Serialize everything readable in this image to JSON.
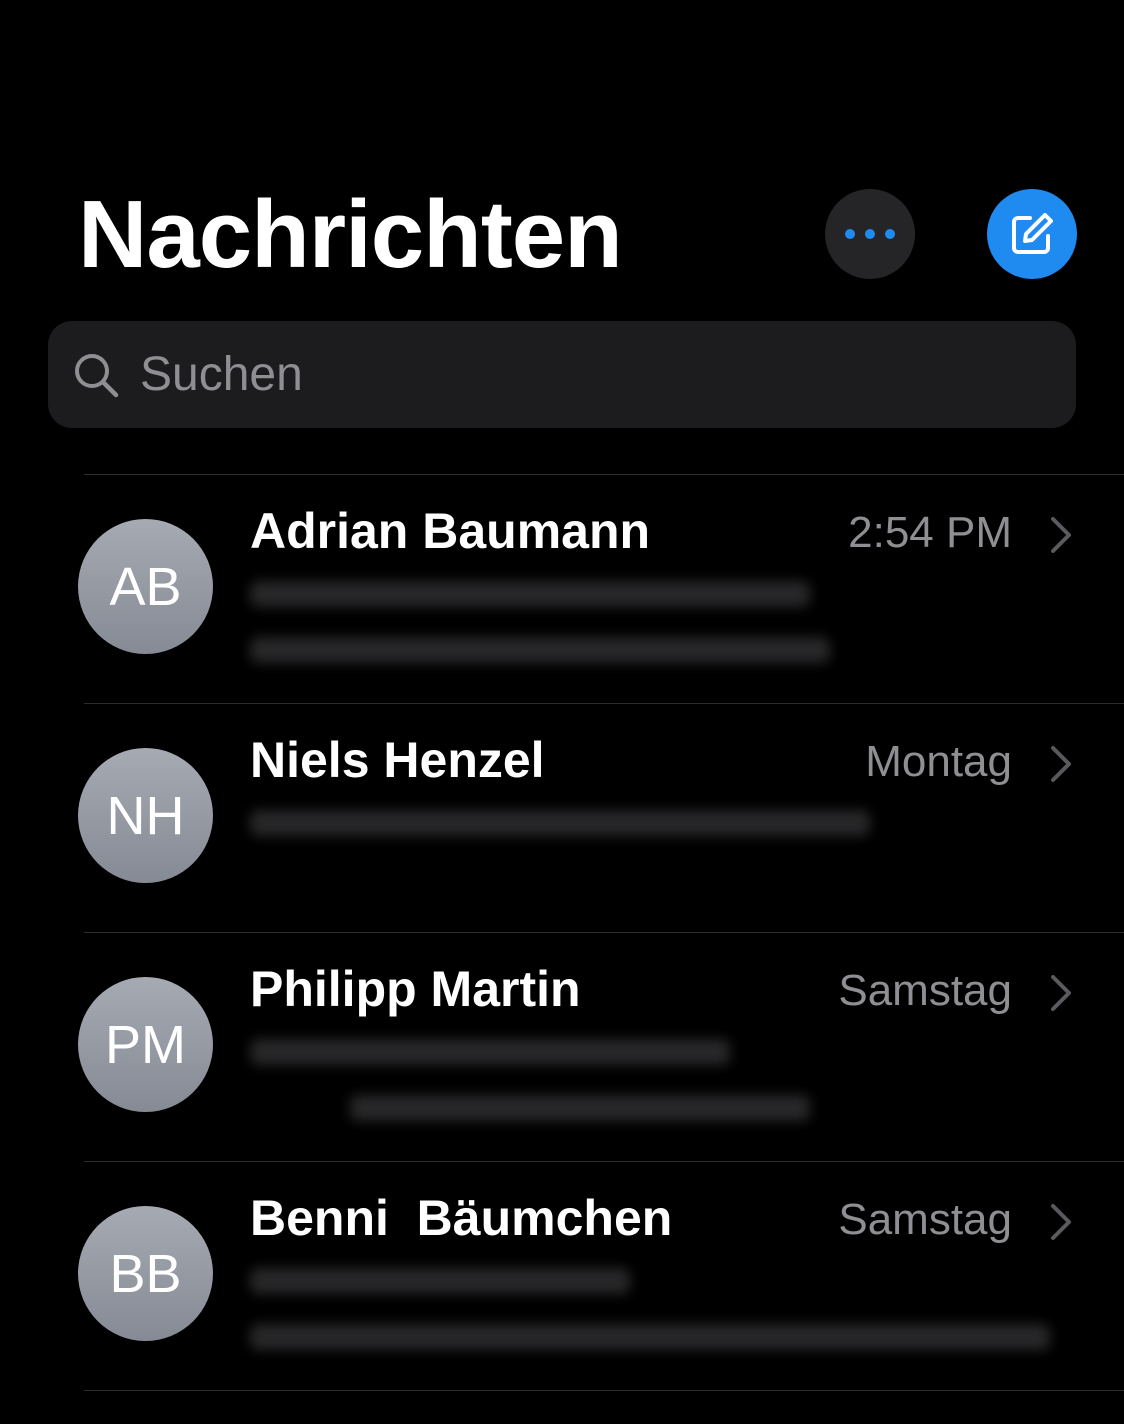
{
  "header": {
    "title": "Nachrichten",
    "more_icon": "ellipsis-icon",
    "compose_icon": "compose-icon",
    "accent_color": "#1f8bf0"
  },
  "search": {
    "placeholder": "Suchen",
    "icon": "search-icon"
  },
  "conversations": [
    {
      "initials": "AB",
      "name": "Adrian Baumann",
      "time": "2:54 PM"
    },
    {
      "initials": "NH",
      "name": "Niels Henzel",
      "time": "Montag"
    },
    {
      "initials": "PM",
      "name": "Philipp Martin",
      "time": "Samstag"
    },
    {
      "initials": "BB",
      "name": "Benni  Bäumchen",
      "time": "Samstag"
    }
  ]
}
